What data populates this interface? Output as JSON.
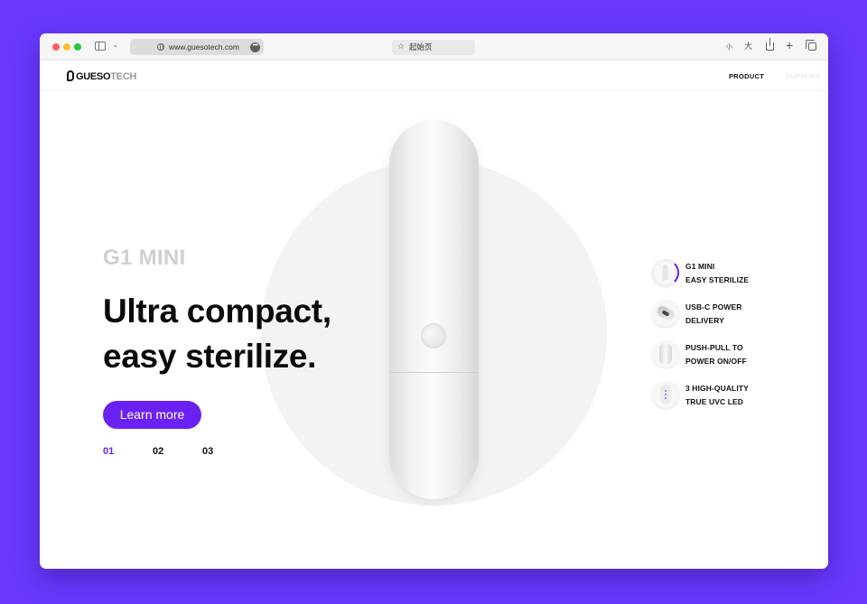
{
  "browser": {
    "url": "www.guesotech.com",
    "tab_title": "起始页",
    "text_small": "小",
    "text_large": "大",
    "more_dots": "•••"
  },
  "site": {
    "logo_bold": "GUESO",
    "logo_light": "TECH",
    "nav": {
      "product": "PRODUCT",
      "support": "SUPPORT"
    }
  },
  "hero": {
    "product_name": "G1 MINI",
    "headline_line1": "Ultra compact,",
    "headline_line2": "easy sterilize.",
    "cta_label": "Learn more",
    "pager": [
      "01",
      "02",
      "03"
    ],
    "active_page": "01"
  },
  "features": [
    {
      "line1": "G1 MINI",
      "line2": "EASY STERILIZE",
      "icon": "mini-device-icon"
    },
    {
      "line1": "USB-C POWER",
      "line2": "DELIVERY",
      "icon": "usb-c-icon"
    },
    {
      "line1": "PUSH-PULL TO",
      "line2": "POWER ON/OFF",
      "icon": "push-pull-icon"
    },
    {
      "line1": "3 HIGH-QUALITY",
      "line2": "TRUE UVC LED",
      "icon": "uvc-led-icon"
    }
  ],
  "colors": {
    "background": "#6a38ff",
    "accent": "#6b21f2",
    "product_name": "#cfcfcf"
  }
}
